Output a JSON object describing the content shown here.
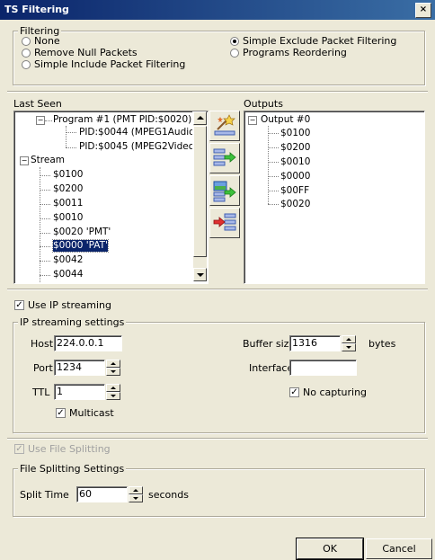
{
  "window": {
    "title": "TS Filtering",
    "close_label": "×"
  },
  "filtering": {
    "group_label": "Filtering",
    "options": [
      {
        "label": "None",
        "selected": false
      },
      {
        "label": "Remove Null Packets",
        "selected": false
      },
      {
        "label": "Simple Include Packet Filtering",
        "selected": false
      },
      {
        "label": "Simple Exclude Packet Filtering",
        "selected": true
      },
      {
        "label": "Programs Reordering",
        "selected": false
      }
    ]
  },
  "last_seen": {
    "label": "Last Seen",
    "items": [
      "Program #1 (PMT PID:$0020)",
      "PID:$0044 (MPEG1Audio)",
      "PID:$0045 (MPEG2Video)",
      "Stream",
      "$0100",
      "$0200",
      "$0011",
      "$0010",
      "$0020 'PMT'",
      "$0000 'PAT'",
      "$0042",
      "$0044"
    ],
    "selected": "$0000 'PAT'"
  },
  "outputs": {
    "label": "Outputs",
    "root": "Output #0",
    "items": [
      "$0100",
      "$0200",
      "$0010",
      "$0000",
      "$00FF",
      "$0020"
    ]
  },
  "ip": {
    "use_label": "Use IP streaming",
    "use_checked": true,
    "group_label": "IP streaming settings",
    "host_label": "Host",
    "host_value": "224.0.0.1",
    "port_label": "Port",
    "port_value": "1234",
    "ttl_label": "TTL",
    "ttl_value": "1",
    "multicast_label": "Multicast",
    "multicast_checked": true,
    "buffer_label": "Buffer size",
    "buffer_value": "1316",
    "buffer_unit": "bytes",
    "interface_label": "Interface",
    "interface_value": "",
    "no_capturing_label": "No capturing",
    "no_capturing_checked": true
  },
  "splitting": {
    "use_label": "Use File Splitting",
    "use_checked": true,
    "group_label": "File Splitting Settings",
    "split_label": "Split Time",
    "split_value": "60",
    "split_unit": "seconds"
  },
  "buttons": {
    "ok": "OK",
    "cancel": "Cancel"
  },
  "colors": {
    "titlebar": "#0a246a",
    "face": "#ece9d8",
    "selection": "#0a246a"
  }
}
